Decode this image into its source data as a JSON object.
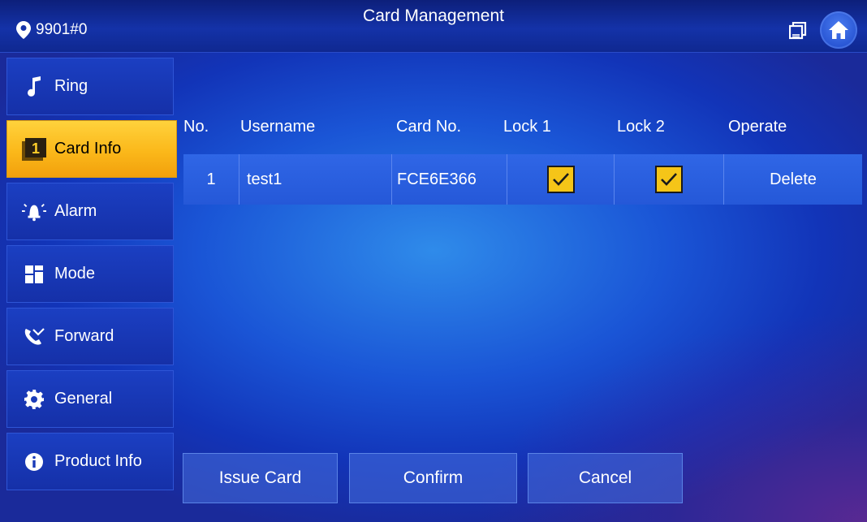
{
  "header": {
    "location": "9901#0",
    "title": "Card Management"
  },
  "sidebar": {
    "items": [
      {
        "label": "Ring",
        "icon": "music-note-icon"
      },
      {
        "label": "Card Info",
        "icon": "card-number-icon",
        "badge": "1",
        "active": true
      },
      {
        "label": "Alarm",
        "icon": "alarm-bell-icon"
      },
      {
        "label": "Mode",
        "icon": "mode-grid-icon"
      },
      {
        "label": "Forward",
        "icon": "call-forward-icon"
      },
      {
        "label": "General",
        "icon": "gear-icon"
      },
      {
        "label": "Product Info",
        "icon": "info-icon"
      }
    ]
  },
  "table": {
    "headers": [
      "No.",
      "Username",
      "Card No.",
      "Lock 1",
      "Lock 2",
      "Operate"
    ],
    "rows": [
      {
        "no": "1",
        "username": "test1",
        "card_no": "FCE6E366",
        "lock1": true,
        "lock2": true,
        "operate": "Delete"
      }
    ]
  },
  "actions": {
    "issue_card": "Issue Card",
    "confirm": "Confirm",
    "cancel": "Cancel"
  },
  "colors": {
    "active_tab": "#fbb81a",
    "checkbox": "#f5c518",
    "background": "#1a55d6"
  }
}
